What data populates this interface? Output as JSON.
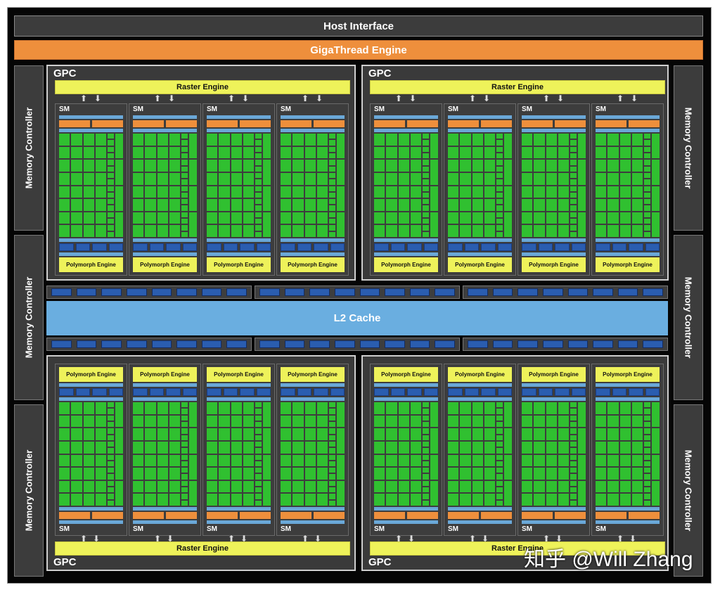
{
  "title": "Host Interface",
  "gigathread": "GigaThread Engine",
  "memory_controller": "Memory Controller",
  "l2_cache": "L2 Cache",
  "gpc_label": "GPC",
  "raster_engine": "Raster Engine",
  "sm_label": "SM",
  "polymorph_engine": "Polymorph Engine",
  "watermark": "知乎 @Will Zhang",
  "colors": {
    "giga": "#ee8f3c",
    "core": "#30c030",
    "raster": "#eef25a",
    "l2": "#6aaee0"
  }
}
